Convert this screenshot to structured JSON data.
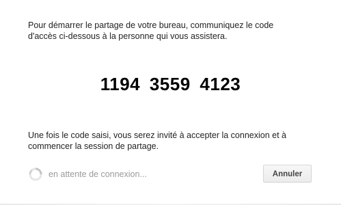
{
  "dialog": {
    "instructions": "Pour démarrer le partage de votre bureau, communiquez le code d'accès ci-dessous à la personne qui vous assistera.",
    "access_code": "1194  3559  4123",
    "followup": "Une fois le code saisi, vous serez invité à accepter la connexion et à commencer la session de partage.",
    "status": {
      "icon": "spinner-icon",
      "text": "en attente de connexion..."
    },
    "cancel_label": "Annuler"
  }
}
